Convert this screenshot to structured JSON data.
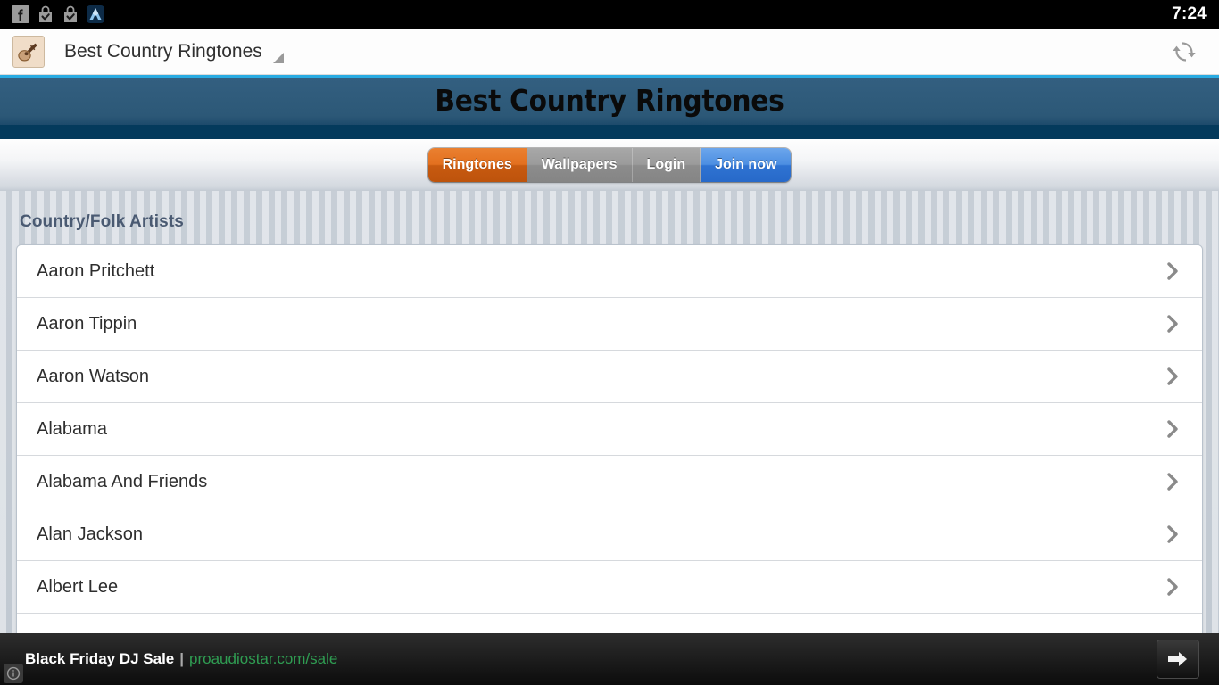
{
  "statusbar": {
    "clock": "7:24",
    "icons": [
      {
        "name": "facebook-icon"
      },
      {
        "name": "play-store-download-complete-icon"
      },
      {
        "name": "play-store-download-complete-icon"
      },
      {
        "name": "app-icon"
      }
    ]
  },
  "browser": {
    "favicon_name": "guitar-icon",
    "title": "Best Country Ringtones",
    "reload_label": "",
    "dropdown_name": "tab-resize-handle"
  },
  "site": {
    "banner_title": "Best Country Ringtones",
    "accent_cyan": "#29abe2",
    "banner_blue": "#2c5877",
    "banner_navy": "#043a5c"
  },
  "nav": {
    "tabs": [
      {
        "label": "Ringtones",
        "style": "orange",
        "color": "#e3701f",
        "active": true
      },
      {
        "label": "Wallpapers",
        "style": "grey",
        "color": "#9b9b9b",
        "active": false
      },
      {
        "label": "Login",
        "style": "grey",
        "color": "#9b9b9b",
        "active": false
      },
      {
        "label": "Join now",
        "style": "blue",
        "color": "#4d8fe2",
        "active": false
      }
    ]
  },
  "main": {
    "section_title": "Country/Folk Artists",
    "artists": [
      {
        "name": "Aaron Pritchett"
      },
      {
        "name": "Aaron Tippin"
      },
      {
        "name": "Aaron Watson"
      },
      {
        "name": "Alabama"
      },
      {
        "name": "Alabama And Friends"
      },
      {
        "name": "Alan Jackson"
      },
      {
        "name": "Albert Lee"
      },
      {
        "name": ""
      }
    ]
  },
  "ad": {
    "headline": "Black Friday DJ Sale",
    "separator": "|",
    "url": "proaudiostar.com/sale",
    "url_color": "#2f9d52",
    "go_name": "ad-go-arrow"
  }
}
